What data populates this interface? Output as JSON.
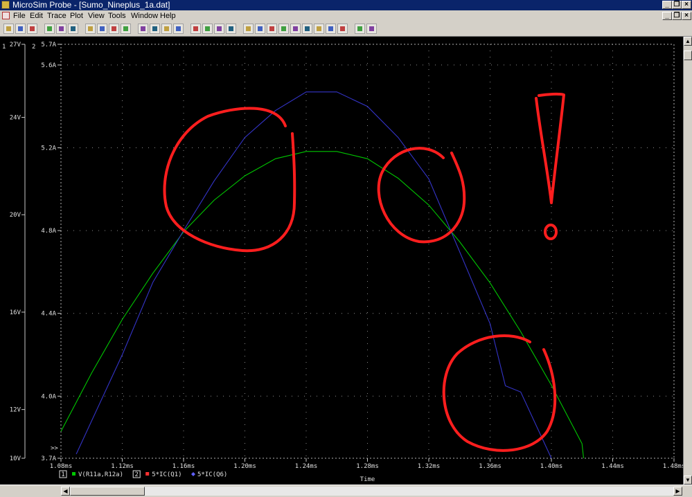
{
  "window": {
    "title": "MicroSim Probe - [Sumo_Nineplus_1a.dat]"
  },
  "menu": [
    "File",
    "Edit",
    "Trace",
    "Plot",
    "View",
    "Tools",
    "Window",
    "Help"
  ],
  "toolbar_icons": [
    "open-icon",
    "open-icon",
    "print-icon",
    "cut-icon",
    "copy-icon",
    "paste-icon",
    "zoom-in-icon",
    "zoom-out-icon",
    "zoom-area-icon",
    "zoom-fit-icon",
    "log-x-icon",
    "fourier-icon",
    "performance-icon",
    "log-y-icon",
    "add-trace-icon",
    "add-y-axis-icon",
    "add-plot-icon",
    "eval-goal-icon",
    "cursor-peak-icon",
    "cursor-trough-icon",
    "cursor-slope-icon",
    "cursor-min-icon",
    "cursor-max-icon",
    "cursor-point-icon",
    "cursor-search-icon",
    "cursor-next-icon",
    "cursor-label-icon",
    "mark-label-icon",
    "mark-data-icon"
  ],
  "chart_data": {
    "type": "line",
    "xlabel": "Time",
    "x_ticks": [
      "1.08ms",
      "1.12ms",
      "1.16ms",
      "1.20ms",
      "1.24ms",
      "1.28ms",
      "1.32ms",
      "1.36ms",
      "1.40ms",
      "1.44ms",
      "1.48ms"
    ],
    "xlim": [
      1.08,
      1.48
    ],
    "grid": true,
    "axes": [
      {
        "id": "1",
        "ticks": [
          "27V",
          "24V",
          "20V",
          "16V",
          "12V",
          "10V"
        ],
        "ylim": [
          10,
          27
        ]
      },
      {
        "id": "2",
        "ticks": [
          "5.7A",
          "5.6A",
          "5.2A",
          "4.8A",
          "4.4A",
          "4.0A",
          "3.7A"
        ],
        "ylim": [
          3.7,
          5.7
        ]
      }
    ],
    "series": [
      {
        "name": "V(R11a,R12a)",
        "axis": "1",
        "color": "#00c800",
        "points": [
          [
            1.08,
            11.1
          ],
          [
            1.1,
            13.5
          ],
          [
            1.12,
            15.7
          ],
          [
            1.14,
            17.6
          ],
          [
            1.16,
            19.3
          ],
          [
            1.18,
            20.6
          ],
          [
            1.2,
            21.6
          ],
          [
            1.22,
            22.3
          ],
          [
            1.24,
            22.6
          ],
          [
            1.26,
            22.6
          ],
          [
            1.28,
            22.3
          ],
          [
            1.3,
            21.5
          ],
          [
            1.32,
            20.4
          ],
          [
            1.34,
            18.9
          ],
          [
            1.36,
            17.2
          ],
          [
            1.38,
            15.2
          ],
          [
            1.4,
            13.0
          ],
          [
            1.42,
            10.6
          ],
          [
            1.421,
            10.0
          ]
        ]
      },
      {
        "name": "5*IC(Q6)",
        "axis": "2",
        "color": "#3434c8",
        "points": [
          [
            1.09,
            3.72
          ],
          [
            1.12,
            4.2
          ],
          [
            1.14,
            4.55
          ],
          [
            1.16,
            4.8
          ],
          [
            1.18,
            5.04
          ],
          [
            1.2,
            5.25
          ],
          [
            1.22,
            5.38
          ],
          [
            1.24,
            5.47
          ],
          [
            1.26,
            5.47
          ],
          [
            1.28,
            5.4
          ],
          [
            1.3,
            5.25
          ],
          [
            1.32,
            5.05
          ],
          [
            1.34,
            4.7
          ],
          [
            1.36,
            4.35
          ],
          [
            1.37,
            4.05
          ],
          [
            1.38,
            4.02
          ],
          [
            1.4,
            3.7
          ]
        ]
      }
    ],
    "legend": [
      {
        "axis": "1",
        "marker": "square",
        "color": "#00c800",
        "label": "V(R11a,R12a)"
      },
      {
        "axis": "2",
        "marker": "square",
        "color": "#ff3030",
        "label": "5*IC(Q1)"
      },
      {
        "axis": "2",
        "marker": "diamond",
        "color": "#6060ff",
        "label": "5*IC(Q6)"
      }
    ],
    "annotations": [
      ">>"
    ]
  }
}
